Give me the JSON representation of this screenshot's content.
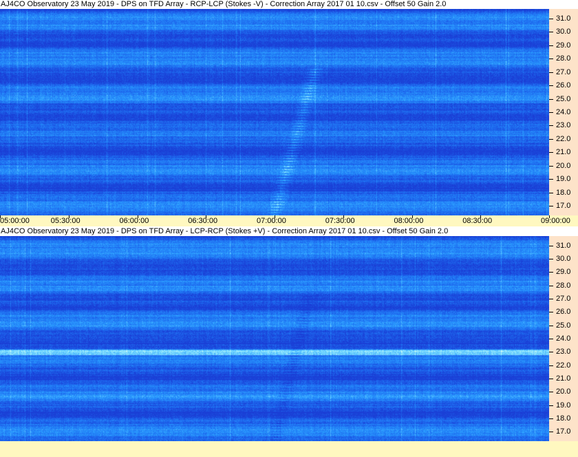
{
  "chart_data": [
    {
      "type": "heatmap",
      "title": "AJ4CO Observatory 23 May 2019  -  DPS on TFD Array  -  RCP-LCP (Stokes -V)  -  Correction Array 2017 01 10.csv  -  Offset 50  Gain 2.0",
      "x_tick_labels": [
        "05:00:00",
        "05:30:00",
        "06:00:00",
        "06:30:00",
        "07:00:00",
        "07:30:00",
        "08:00:00",
        "08:30:00",
        "09:00:00"
      ],
      "y_tick_labels": [
        "31.0",
        "30.0",
        "29.0",
        "28.0",
        "27.0",
        "26.0",
        "25.0",
        "24.0",
        "23.0",
        "22.0",
        "21.0",
        "20.0",
        "19.0",
        "18.0",
        "17.0"
      ],
      "xlim": [
        "05:00:00",
        "09:00:00"
      ],
      "ylim": [
        16.3,
        31.7
      ],
      "colormap": [
        "#1a3fd6",
        "#1e6cf0",
        "#2a9cff",
        "#7fe0ff",
        "#e8fff0"
      ]
    },
    {
      "type": "heatmap",
      "title": "AJ4CO Observatory 23 May 2019  -  DPS on TFD Array  -  LCP-RCP (Stokes +V)  -  Correction Array 2017 01 10.csv  -  Offset 50  Gain 2.0",
      "x_tick_labels": [],
      "y_tick_labels": [
        "31.0",
        "30.0",
        "29.0",
        "28.0",
        "27.0",
        "26.0",
        "25.0",
        "24.0",
        "23.0",
        "22.0",
        "21.0",
        "20.0",
        "19.0",
        "18.0",
        "17.0"
      ],
      "xlim": [
        "05:00:00",
        "09:00:00"
      ],
      "ylim": [
        16.3,
        31.7
      ],
      "colormap": [
        "#1a3fd6",
        "#1e6cf0",
        "#2a9cff",
        "#7fe0ff",
        "#e8fff0"
      ]
    }
  ]
}
